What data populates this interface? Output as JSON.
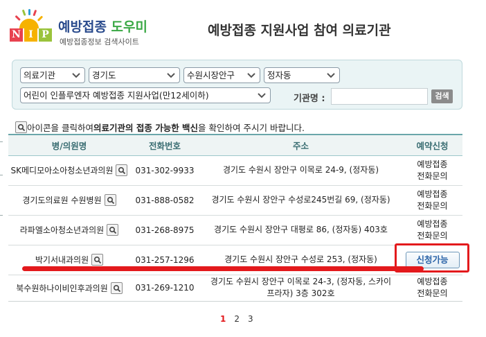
{
  "header": {
    "logo_letters": [
      "N",
      "I",
      "P"
    ],
    "logo_colors": [
      "#e8424f",
      "#f6b200",
      "#9ac33c"
    ],
    "brand_main": "예방접종",
    "brand_accent": "도우미",
    "brand_sub": "예방접종정보 검색사이트",
    "page_title": "예방접종 지원사업 참여 의료기관"
  },
  "filters": {
    "category": "의료기관",
    "province": "경기도",
    "city": "수원시장안구",
    "district": "정자동",
    "program": "어린이 인플루엔자 예방접종 지원사업(만12세이하)",
    "name_label": "기관명 :",
    "name_value": "",
    "search_button": "검색"
  },
  "notice": {
    "before": " 아이콘을 클릭하여 ",
    "strong": "의료기관의 접종 가능한 백신",
    "after": "을 확인하여 주시기 바랍니다."
  },
  "table": {
    "headers": [
      "병/의원명",
      "전화번호",
      "주소",
      "예약신청"
    ],
    "rows": [
      {
        "name": "SK메디모아소아청소년과의원",
        "phone": "031-302-9933",
        "address": "경기도 수원시 장안구 이목로 24-9, (정자동)",
        "reservation": "예방접종\n전화문의"
      },
      {
        "name": "경기도의료원 수원병원",
        "phone": "031-888-0582",
        "address": "경기도 수원시 장안구 수성로245번길 69, (정자동)",
        "reservation": "예방접종\n전화문의"
      },
      {
        "name": "라파엘소아청소년과의원",
        "phone": "031-268-8975",
        "address": "경기도 수원시 장안구 대평로 86, (정자동) 403호",
        "reservation": "예방접종\n전화문의"
      },
      {
        "name": "박기서내과의원",
        "phone": "031-257-1296",
        "address": "경기도 수원시 장안구 수성로 253, (정자동)",
        "reservation": "신청가능"
      },
      {
        "name": "북수원하나이비인후과의원",
        "phone": "031-269-1210",
        "address": "경기도 수원시 장안구 이목로 24-3, (정자동, 스카이\n프라자) 3층 302호",
        "reservation": "예방접종\n전화문의"
      }
    ]
  },
  "pagination": {
    "pages": [
      "1",
      "2",
      "3"
    ],
    "current": "1"
  },
  "colors": {
    "accent_red": "#e3191c",
    "header_teal": "#3b6e73",
    "brand_blue": "#2a4b8d",
    "brand_green": "#3aa845"
  },
  "icons": [
    "sun-logo-icon",
    "chevron-down-icon",
    "magnifier-icon"
  ]
}
